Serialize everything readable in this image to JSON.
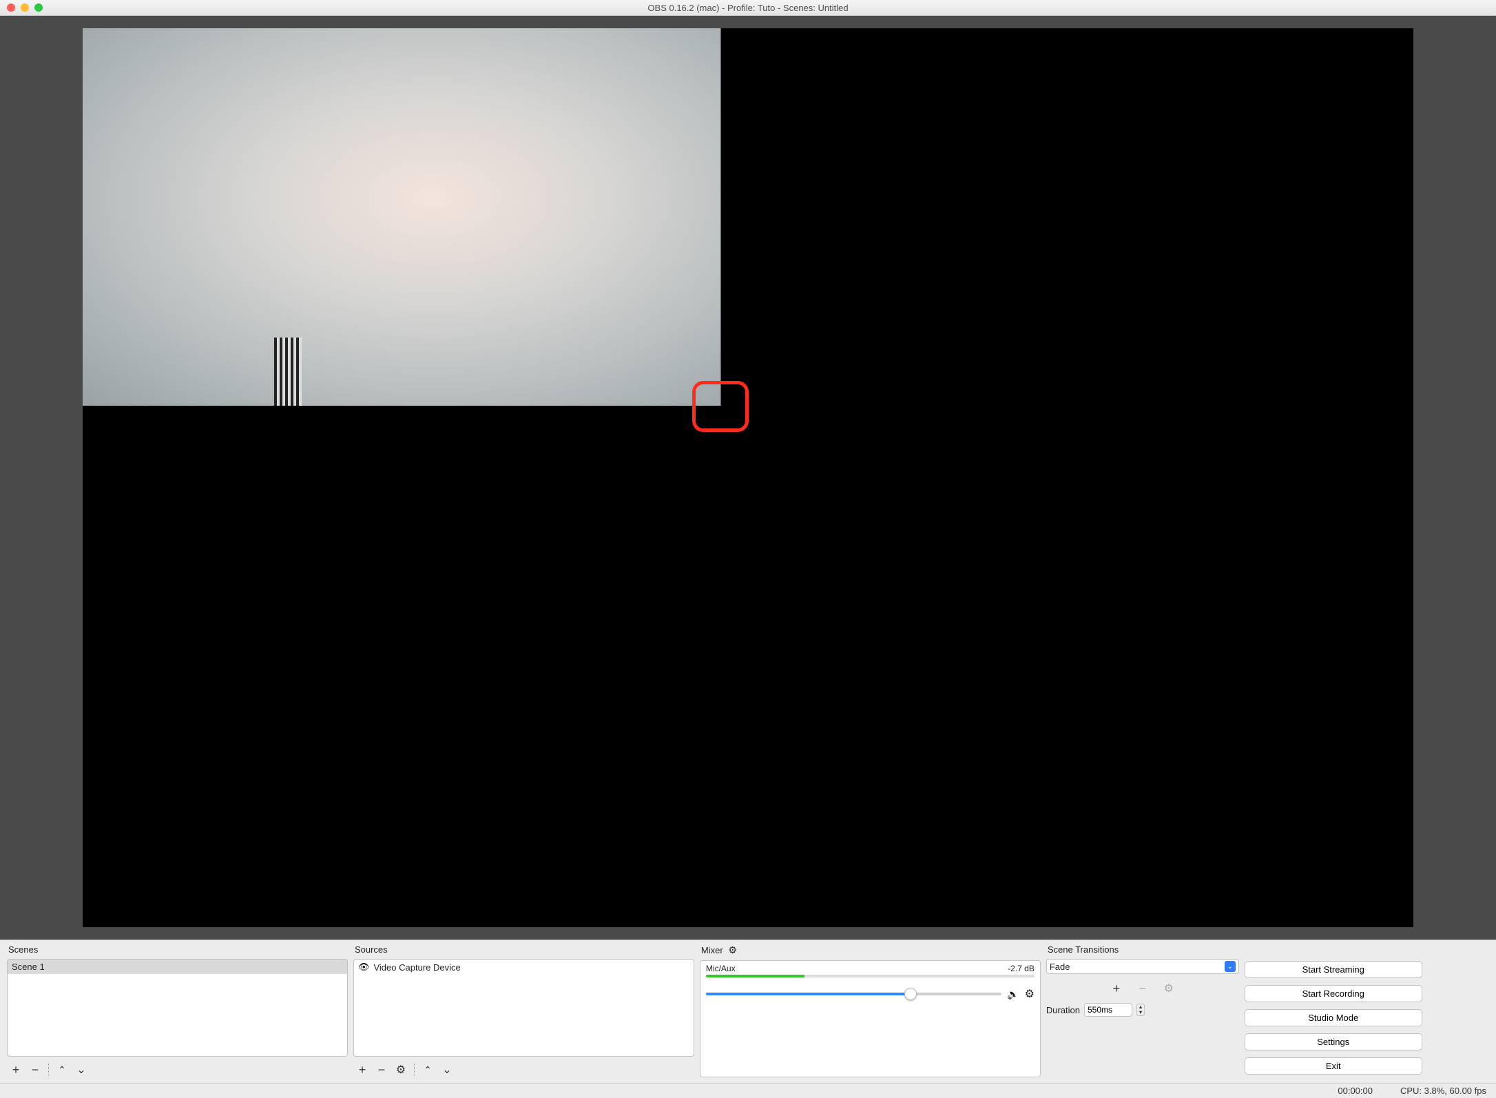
{
  "window": {
    "title": "OBS 0.16.2 (mac) - Profile: Tuto - Scenes: Untitled"
  },
  "panels": {
    "scenes": {
      "header": "Scenes",
      "items": [
        "Scene 1"
      ],
      "selected_index": 0
    },
    "sources": {
      "header": "Sources",
      "items": [
        "Video Capture Device"
      ]
    },
    "mixer": {
      "header": "Mixer",
      "channel_name": "Mic/Aux",
      "level_db": "-2.7 dB"
    },
    "transitions": {
      "header": "Scene Transitions",
      "selected": "Fade",
      "duration_label": "Duration",
      "duration_value": "550ms"
    }
  },
  "controls": {
    "start_streaming": "Start Streaming",
    "start_recording": "Start Recording",
    "studio_mode": "Studio Mode",
    "settings": "Settings",
    "exit": "Exit"
  },
  "status": {
    "time": "00:00:00",
    "cpu_fps": "CPU: 3.8%, 60.00 fps"
  },
  "icons": {
    "plus": "plus-icon",
    "minus": "minus-icon",
    "up": "chevron-up-icon",
    "down": "chevron-down-icon",
    "gear": "gear-icon",
    "eye": "eye-icon",
    "speaker": "speaker-icon"
  },
  "annotation": {
    "red_box_note": "red rounded rectangle highlight near lower-right corner of webcam source in preview"
  }
}
